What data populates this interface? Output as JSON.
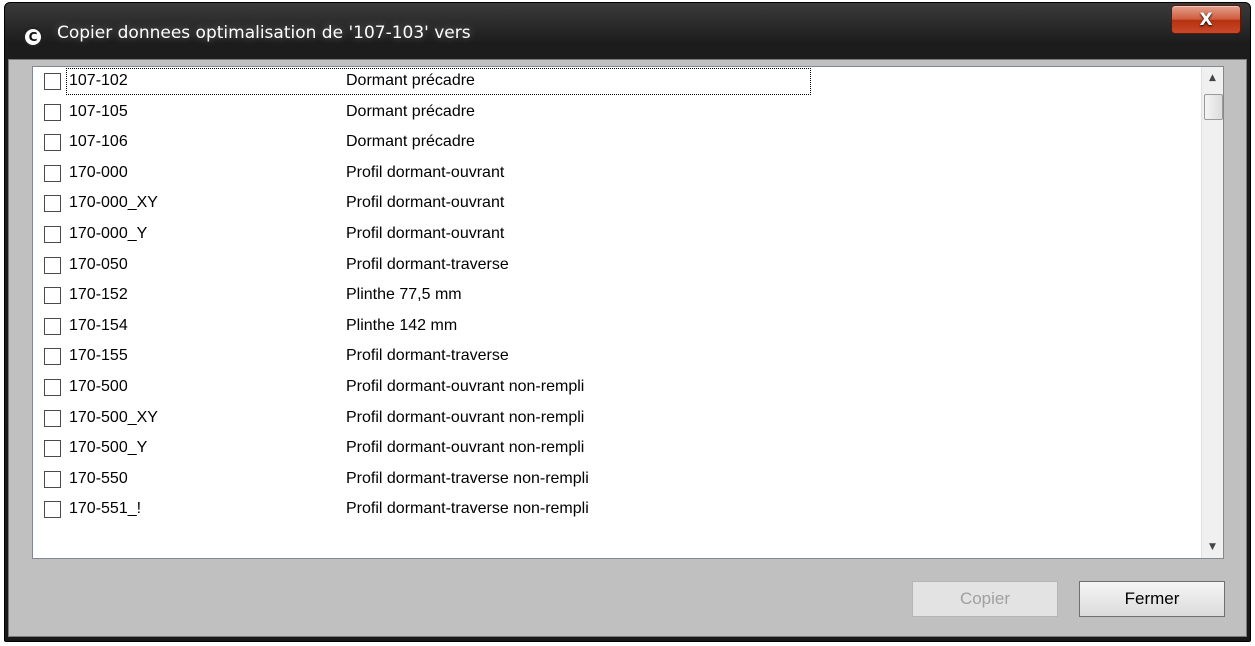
{
  "window": {
    "title": "Copier donnees optimalisation de '107-103' vers",
    "app_icon": "copyright-c-icon",
    "close_label": "X"
  },
  "list": {
    "items": [
      {
        "code": "107-102",
        "desc": "Dormant précadre",
        "checked": false
      },
      {
        "code": "107-105",
        "desc": "Dormant précadre",
        "checked": false
      },
      {
        "code": "107-106",
        "desc": "Dormant précadre",
        "checked": false
      },
      {
        "code": "170-000",
        "desc": "Profil dormant-ouvrant",
        "checked": false
      },
      {
        "code": "170-000_XY",
        "desc": "Profil dormant-ouvrant",
        "checked": false
      },
      {
        "code": "170-000_Y",
        "desc": "Profil dormant-ouvrant",
        "checked": false
      },
      {
        "code": "170-050",
        "desc": "Profil dormant-traverse",
        "checked": false
      },
      {
        "code": "170-152",
        "desc": "Plinthe 77,5 mm",
        "checked": false
      },
      {
        "code": "170-154",
        "desc": "Plinthe 142 mm",
        "checked": false
      },
      {
        "code": "170-155",
        "desc": "Profil dormant-traverse",
        "checked": false
      },
      {
        "code": "170-500",
        "desc": "Profil dormant-ouvrant non-rempli",
        "checked": false
      },
      {
        "code": "170-500_XY",
        "desc": "Profil dormant-ouvrant non-rempli",
        "checked": false
      },
      {
        "code": "170-500_Y",
        "desc": "Profil dormant-ouvrant non-rempli",
        "checked": false
      },
      {
        "code": "170-550",
        "desc": "Profil dormant-traverse non-rempli",
        "checked": false
      },
      {
        "code": "170-551_!",
        "desc": "Profil dormant-traverse non-rempli",
        "checked": false
      }
    ]
  },
  "buttons": {
    "copier": "Copier",
    "fermer": "Fermer"
  },
  "colors": {
    "close_button": "#c8492a",
    "dialog_background": "#c0c0c0",
    "disabled_text": "#a0a0a0"
  }
}
